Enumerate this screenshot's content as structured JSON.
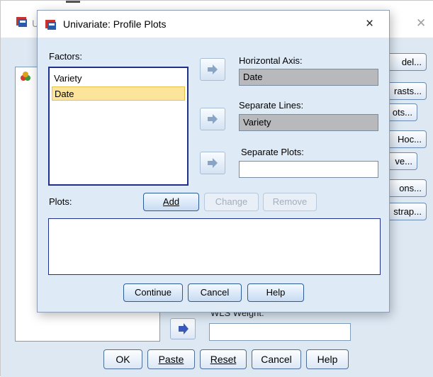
{
  "background_dialog": {
    "title_fragment": "U",
    "side_buttons": [
      "del...",
      "rasts...",
      "ots...",
      "Hoc...",
      "ve...",
      "ons...",
      "strap..."
    ],
    "wls_label": "WLS Weight:",
    "bottom_buttons": [
      "OK",
      "Paste",
      "Reset",
      "Cancel",
      "Help"
    ]
  },
  "dialog": {
    "title": "Univariate: Profile Plots",
    "close_glyph": "×",
    "factors": {
      "label": "Factors:",
      "items": [
        "Variety",
        "Date"
      ],
      "selected_index": 1
    },
    "horizontal_axis": {
      "label": "Horizontal Axis:",
      "value": "Date"
    },
    "separate_lines": {
      "label": "Separate Lines:",
      "value": "Variety"
    },
    "separate_plots": {
      "label": "Separate Plots:",
      "value": ""
    },
    "plots": {
      "label": "Plots:",
      "add": "Add",
      "change": "Change",
      "remove": "Remove"
    },
    "buttons": {
      "continue": "Continue",
      "cancel": "Cancel",
      "help": "Help"
    }
  },
  "colors": {
    "dialog_bg": "#dfeaf7",
    "selection": "#fce59a",
    "filled_field": "#b7b9bd",
    "list_border": "#1f2f8a",
    "arrow_icon": "#8aa4c6",
    "arrow_icon_active": "#3b57b8"
  },
  "icons": [
    "spss-app-icon",
    "close-icon",
    "move-right-arrow-icon",
    "factor-list-icon"
  ]
}
